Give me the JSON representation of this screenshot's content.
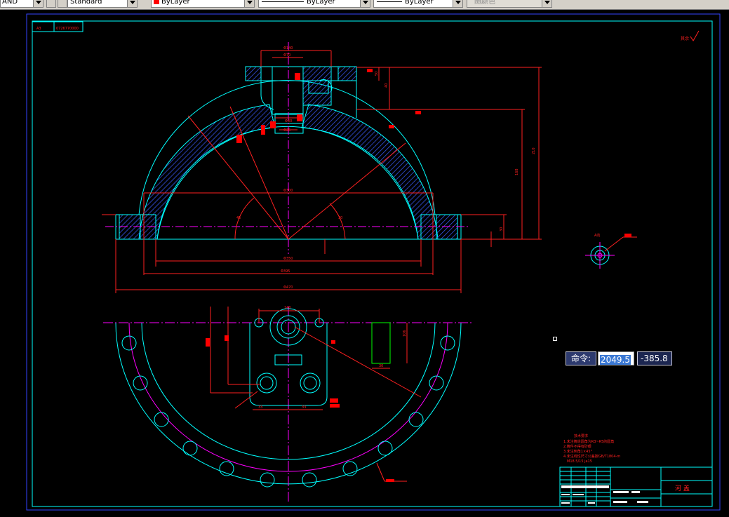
{
  "toolbar": {
    "combo1": "AND",
    "combo2": "Standard",
    "layer": "ByLayer",
    "linetype": "ByLayer",
    "lineweight": "ByLayer",
    "plotstyle": "随颜色"
  },
  "drawing": {
    "title_block_header": "A3",
    "title_block_code": "0726770000",
    "part_name": "河 盖",
    "roughness_note": "其余",
    "notes": [
      "技术要求",
      "1.未注铸造圆角为R3~R5的圆角",
      "2.铸件不得有砂眼",
      "3.未注倒角1×45°",
      "4.未注线性尺寸公差按GB/T1804-m",
      "M18.5/15 ja15"
    ],
    "dims": {
      "top_width": "Φ140",
      "top_inner": "Φ70",
      "boss_dia": "Φ30",
      "boss_inner": "Φ25",
      "bore": "Φ300",
      "flange_inner": "Φ350",
      "flange_outer": "Φ395",
      "overall": "Φ470",
      "height_total": "210",
      "height_mid": "168",
      "h1": "40",
      "h2": "30",
      "h3": "50",
      "angle_left": "45",
      "angle_right": "30",
      "plan_width": "140",
      "plan_h": "106",
      "plan_w2": "30",
      "hole_sp1": "33",
      "hole_sp2": "33",
      "detail_label": "A向"
    }
  },
  "command": {
    "label": "命令:",
    "x_value": "2049.5",
    "y_value": "-385.8"
  },
  "colors": {
    "background": "#000000",
    "outline": "#00ffff",
    "dimension": "#ff0000",
    "center": "#ff00ff",
    "hatch": "#3a5cff",
    "text": "#ff2020"
  }
}
